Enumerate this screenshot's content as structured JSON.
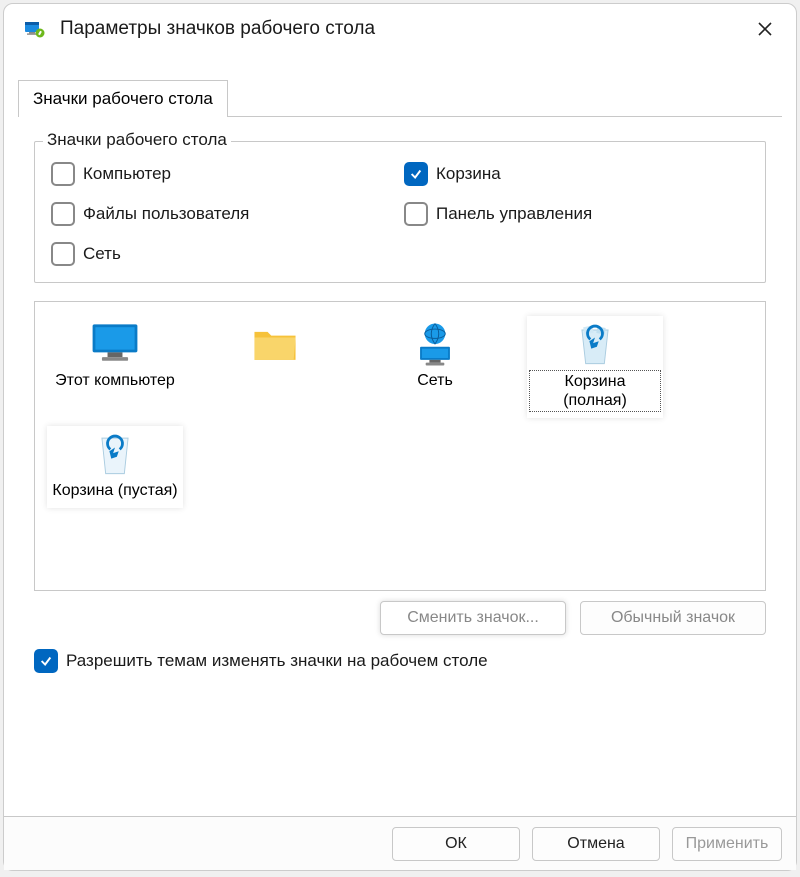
{
  "titlebar": {
    "title": "Параметры значков рабочего стола"
  },
  "tab": {
    "label": "Значки рабочего стола"
  },
  "fieldset": {
    "legend": "Значки рабочего стола",
    "checkboxes": {
      "computer": {
        "label": "Компьютер",
        "checked": false
      },
      "recycle": {
        "label": "Корзина",
        "checked": true
      },
      "userfiles": {
        "label": "Файлы пользователя",
        "checked": false
      },
      "controlpanel": {
        "label": "Панель управления",
        "checked": false
      },
      "network": {
        "label": "Сеть",
        "checked": false
      }
    }
  },
  "icons": {
    "thispc": "Этот компьютер",
    "network": "Сеть",
    "recycle_full": "Корзина (полная)",
    "recycle_empty": "Корзина (пустая)"
  },
  "buttons": {
    "change_icon": "Сменить значок...",
    "default_icon": "Обычный значок"
  },
  "allow_themes": {
    "label": "Разрешить темам изменять значки на рабочем столе",
    "checked": true
  },
  "bottom": {
    "ok": "ОК",
    "cancel": "Отмена",
    "apply": "Применить"
  }
}
